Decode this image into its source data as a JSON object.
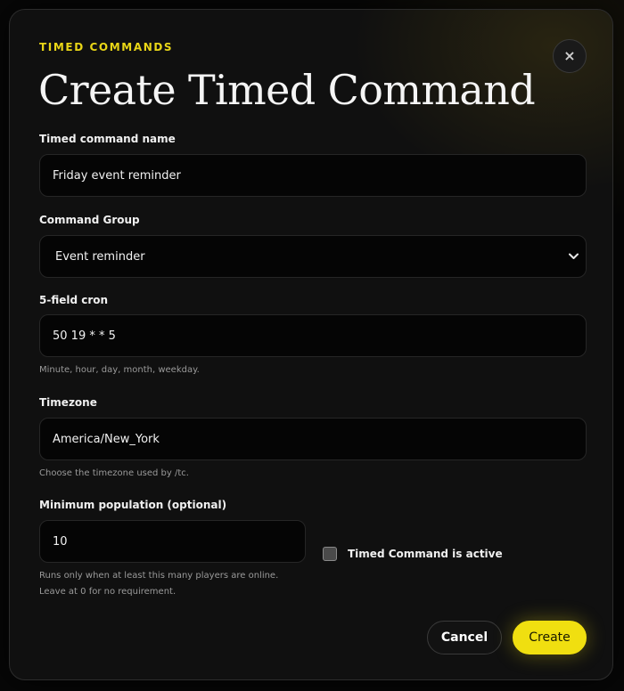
{
  "dialog": {
    "eyebrow": "TIMED COMMANDS",
    "title": "Create Timed Command",
    "close_label": "×"
  },
  "form": {
    "name": {
      "label": "Timed command name",
      "value": "Friday event reminder"
    },
    "group": {
      "label": "Command Group",
      "selected": "Event reminder"
    },
    "cron": {
      "label": "5-field cron",
      "value": "50 19 * * 5",
      "hint": "Minute, hour, day, month, weekday."
    },
    "timezone": {
      "label": "Timezone",
      "value": "America/New_York",
      "hint": "Choose the timezone used by /tc."
    },
    "population": {
      "label": "Minimum population (optional)",
      "value": "10",
      "hint": "Runs only when at least this many players are online. Leave at 0 for no requirement."
    },
    "active": {
      "label": "Timed Command is active",
      "checked": false
    }
  },
  "actions": {
    "cancel_label": "Cancel",
    "create_label": "Create"
  },
  "colors": {
    "accent": "#f0df10",
    "background": "#101010",
    "field_background": "#050505"
  },
  "icons": {
    "close": "close-icon",
    "select_chevron": "chevron-down-icon"
  }
}
